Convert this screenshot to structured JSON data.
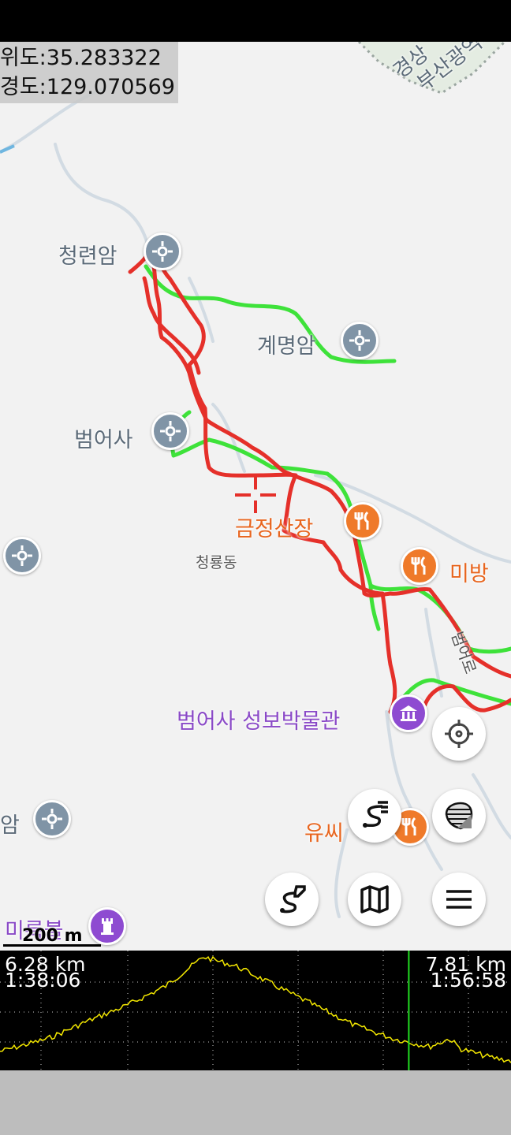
{
  "coords": {
    "lat": "위도:35.283322",
    "lon": "경도:129.070569"
  },
  "map": {
    "region_label_1": "경상",
    "region_label_2": "부산광역시",
    "pois": [
      {
        "label": "청련암",
        "kind": "temple"
      },
      {
        "label": "계명암",
        "kind": "temple"
      },
      {
        "label": "범어사",
        "kind": "temple"
      },
      {
        "label": "금정산장",
        "kind": "restaurant"
      },
      {
        "label": "청룡동",
        "kind": "area"
      },
      {
        "label": "미방",
        "kind": "restaurant"
      },
      {
        "label": "범어사 성보박물관",
        "kind": "museum"
      },
      {
        "label": "암",
        "kind": "temple"
      },
      {
        "label": "유씨",
        "kind": "restaurant"
      },
      {
        "label": "미륵불",
        "kind": "landmark"
      }
    ],
    "road_label": "범어로",
    "scale_label": "200 m",
    "colors": {
      "track_red": "#e5302a",
      "track_green": "#3ee23a",
      "background": "#f2f2f2"
    }
  },
  "buttons": {
    "locate": "crosshair-icon",
    "layers": "layers-icon",
    "tracks": "route-list-icon",
    "route": "route-edit-icon",
    "map": "map-icon",
    "menu": "menu-icon"
  },
  "elevation": {
    "left_distance": "6.28 km",
    "left_time": "1:38:06",
    "right_distance": "7.81 km",
    "right_time": "1:56:58",
    "cursor_position": 0.8,
    "colors": {
      "profile": "#f2e600",
      "cursor": "#22dd22",
      "grid": "#ffffff"
    }
  }
}
